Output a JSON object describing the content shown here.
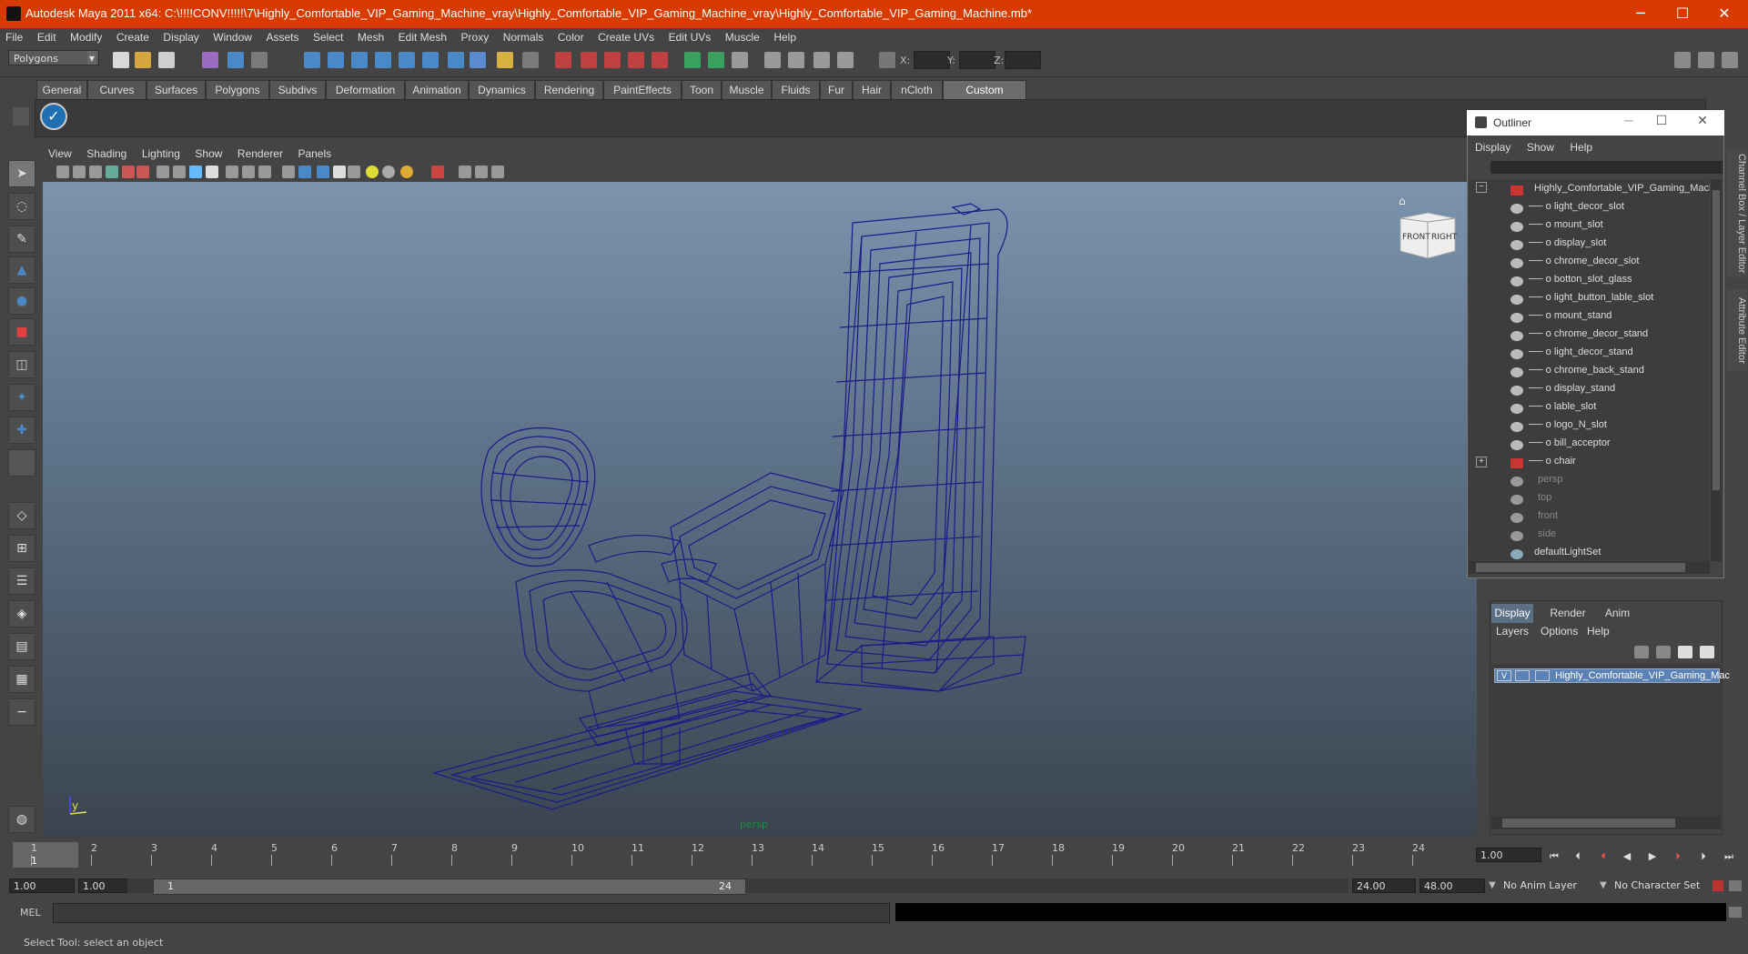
{
  "window": {
    "title": "Autodesk Maya 2011 x64: C:\\!!!!CONV!!!!!\\7\\Highly_Comfortable_VIP_Gaming_Machine_vray\\Highly_Comfortable_VIP_Gaming_Machine_vray\\Highly_Comfortable_VIP_Gaming_Machine.mb*",
    "minimize": "─",
    "maximize": "☐",
    "close": "✕"
  },
  "menubar": [
    "File",
    "Edit",
    "Modify",
    "Create",
    "Display",
    "Window",
    "Assets",
    "Select",
    "Mesh",
    "Edit Mesh",
    "Proxy",
    "Normals",
    "Color",
    "Create UVs",
    "Edit UVs",
    "Muscle",
    "Help"
  ],
  "statusline": {
    "mode": "Polygons",
    "x_label": "X:",
    "y_label": "Y:",
    "z_label": "Z:"
  },
  "shelf_tabs": [
    {
      "label": "General",
      "active": false
    },
    {
      "label": "Curves",
      "active": false
    },
    {
      "label": "Surfaces",
      "active": false
    },
    {
      "label": "Polygons",
      "active": false
    },
    {
      "label": "Subdivs",
      "active": false
    },
    {
      "label": "Deformation",
      "active": false
    },
    {
      "label": "Animation",
      "active": false
    },
    {
      "label": "Dynamics",
      "active": false
    },
    {
      "label": "Rendering",
      "active": false
    },
    {
      "label": "PaintEffects",
      "active": false
    },
    {
      "label": "Toon",
      "active": false
    },
    {
      "label": "Muscle",
      "active": false
    },
    {
      "label": "Fluids",
      "active": false
    },
    {
      "label": "Fur",
      "active": false
    },
    {
      "label": "Hair",
      "active": false
    },
    {
      "label": "nCloth",
      "active": false
    },
    {
      "label": "Custom",
      "active": true
    }
  ],
  "shelf_icon": "✓",
  "viewport": {
    "menu": [
      "View",
      "Shading",
      "Lighting",
      "Show",
      "Renderer",
      "Panels"
    ],
    "camera_label": "persp",
    "viewcube": {
      "front": "FRONT",
      "right": "RIGHT"
    },
    "axis_y": "y"
  },
  "outliner": {
    "title": "Outliner",
    "menu": [
      "Display",
      "Show",
      "Help"
    ],
    "root": "Highly_Comfortable_VIP_Gaming_Machi",
    "children": [
      "light_decor_slot",
      "mount_slot",
      "display_slot",
      "chrome_decor_slot",
      "botton_slot_glass",
      "light_button_lable_slot",
      "mount_stand",
      "chrome_decor_stand",
      "light_decor_stand",
      "chrome_back_stand",
      "display_stand",
      "lable_slot",
      "logo_N_slot",
      "bill_acceptor",
      "chair"
    ],
    "cameras": [
      "persp",
      "top",
      "front",
      "side"
    ],
    "sets": [
      "defaultLightSet"
    ],
    "expand_minus": "−",
    "expand_plus": "+"
  },
  "side_tabs": {
    "channel_box": "Channel Box / Layer Editor",
    "attribute_editor": "Attribute Editor"
  },
  "layer_editor": {
    "tabs": [
      {
        "label": "Display",
        "active": true
      },
      {
        "label": "Render",
        "active": false
      },
      {
        "label": "Anim",
        "active": false
      }
    ],
    "menu": [
      "Layers",
      "Options",
      "Help"
    ],
    "layer": {
      "visible": "V",
      "name": "Highly_Comfortable_VIP_Gaming_Mac"
    }
  },
  "timeline": {
    "frames": [
      "1",
      "2",
      "3",
      "4",
      "5",
      "6",
      "7",
      "8",
      "9",
      "10",
      "11",
      "12",
      "13",
      "14",
      "15",
      "16",
      "17",
      "18",
      "19",
      "20",
      "21",
      "22",
      "23",
      "24"
    ],
    "current_frame": "1",
    "current_time": "1.00"
  },
  "range": {
    "start_time": "1.00",
    "playback_start": "1.00",
    "range_start": "1",
    "range_end": "24",
    "playback_end": "24.00",
    "end_time": "48.00",
    "anim_layer": "No Anim Layer",
    "character_set": "No Character Set"
  },
  "command": {
    "mel_label": "MEL"
  },
  "help_line": "Select Tool: select an object",
  "colors": {
    "title_bar": "#d83b01",
    "wireframe": "#1a1a8a",
    "selected_tab": "#5b6f85"
  }
}
